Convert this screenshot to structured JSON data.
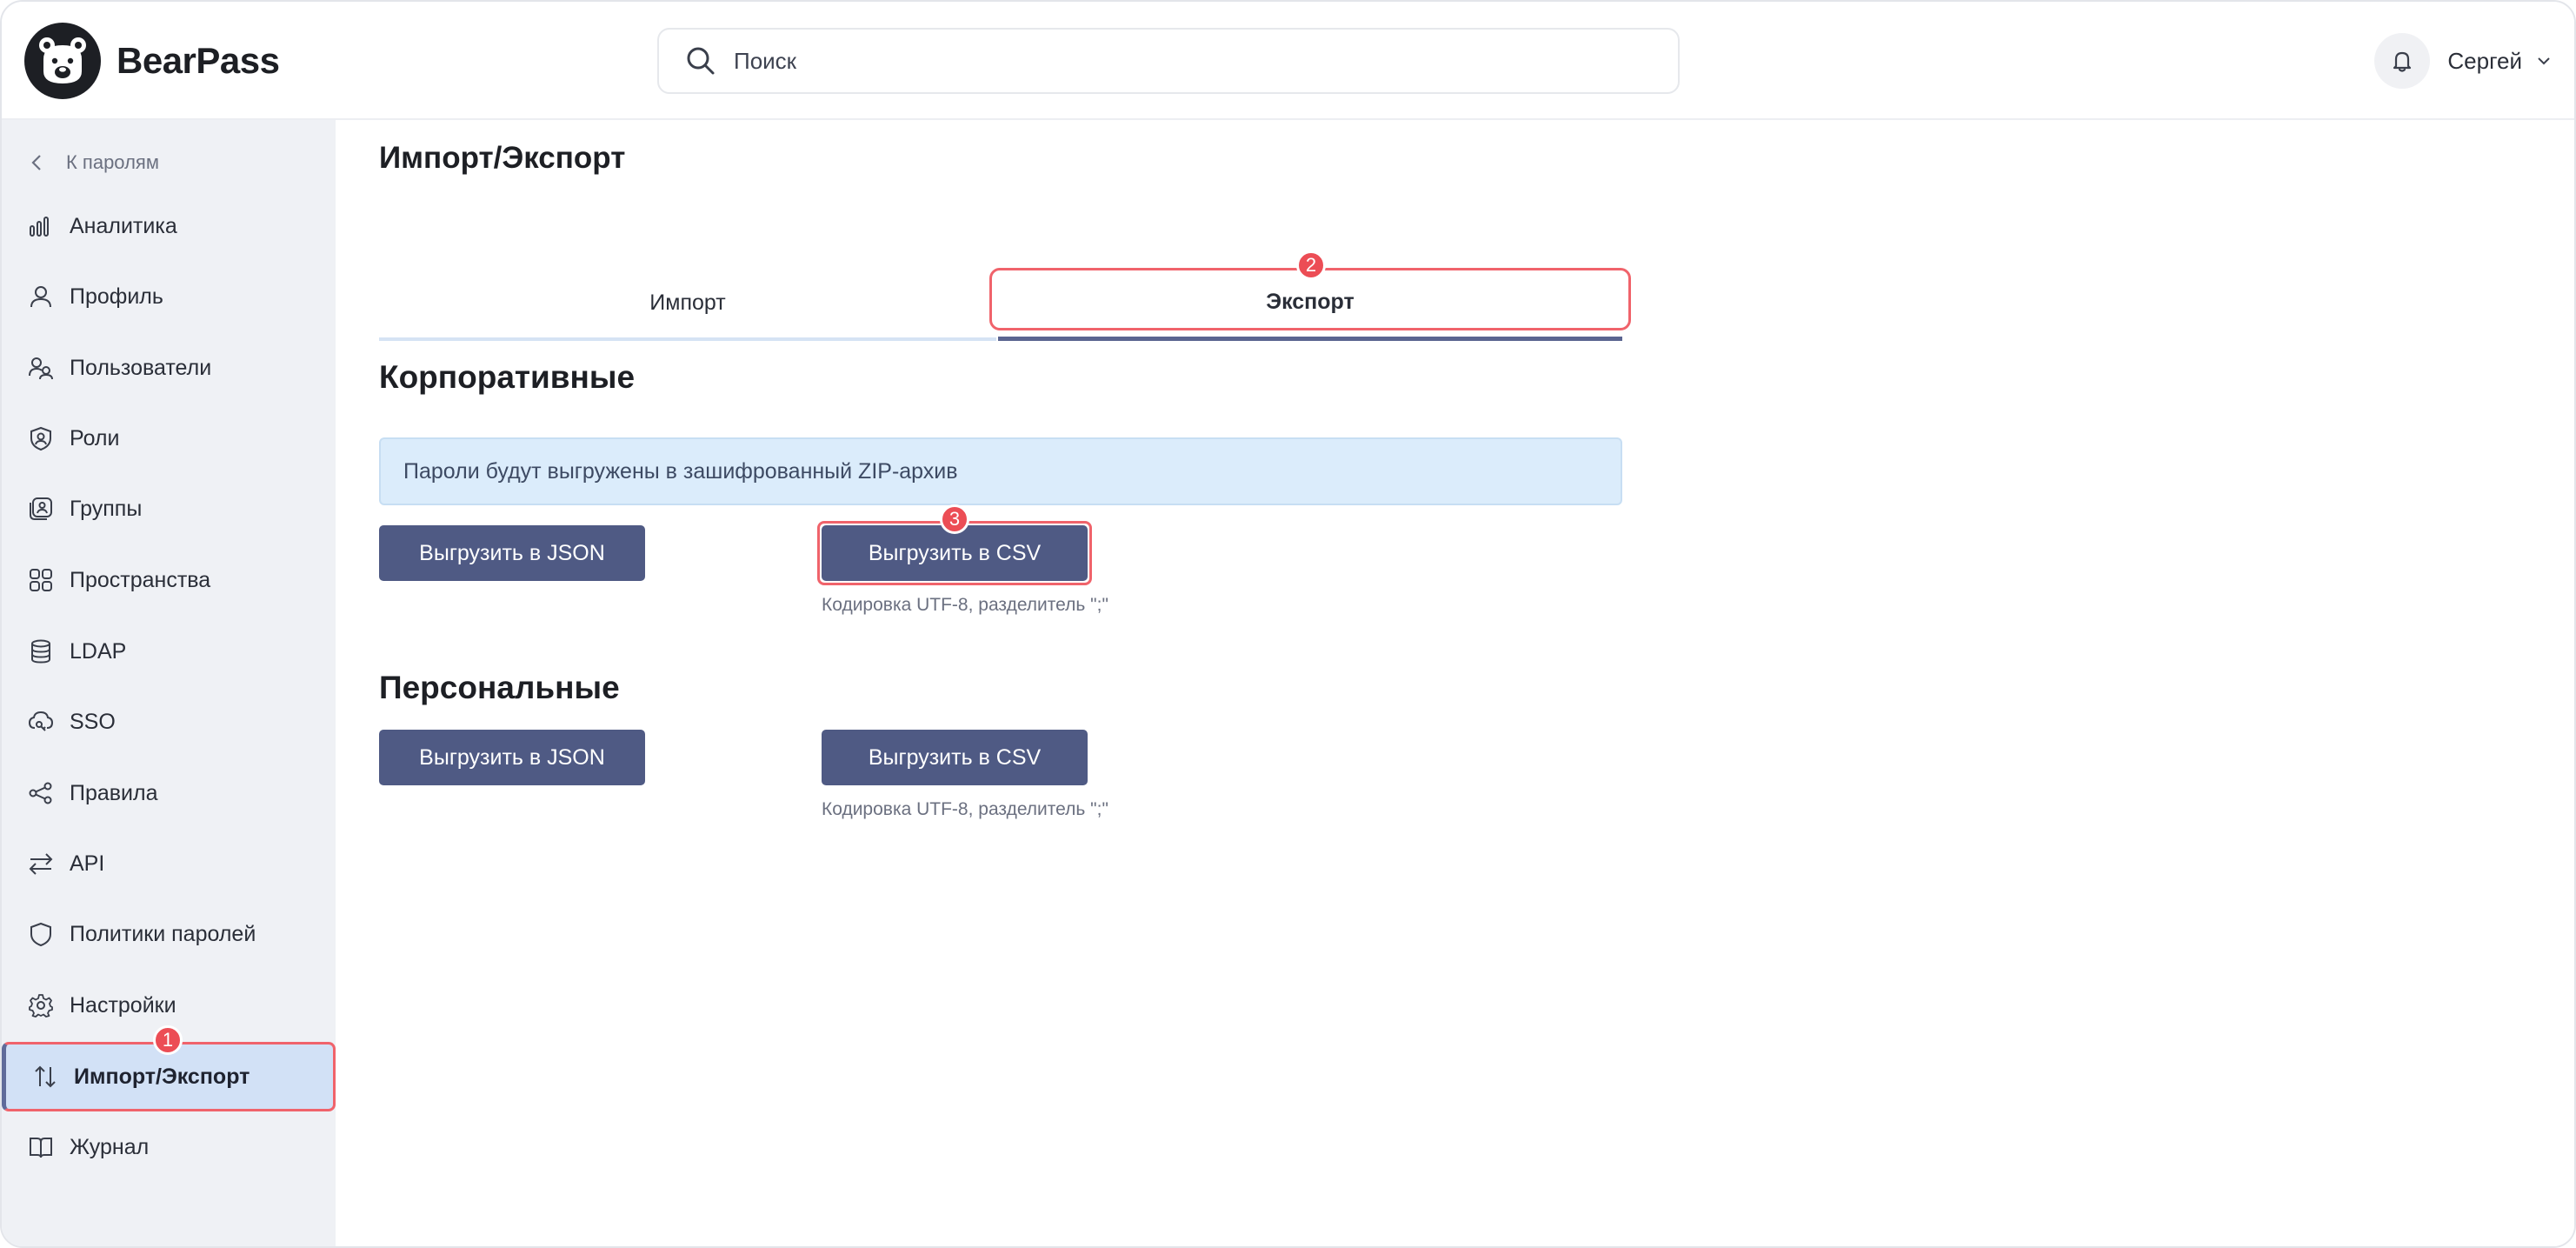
{
  "app": {
    "name": "BearPass"
  },
  "header": {
    "search_placeholder": "Поиск",
    "user_name": "Сергей"
  },
  "sidebar": {
    "back_label": "К паролям",
    "items": [
      {
        "label": "Аналитика",
        "icon": "bar-chart-icon"
      },
      {
        "label": "Профиль",
        "icon": "user-icon"
      },
      {
        "label": "Пользователи",
        "icon": "users-icon"
      },
      {
        "label": "Роли",
        "icon": "role-shield-icon"
      },
      {
        "label": "Группы",
        "icon": "group-icon"
      },
      {
        "label": "Пространства",
        "icon": "grid-icon"
      },
      {
        "label": "LDAP",
        "icon": "database-icon"
      },
      {
        "label": "SSO",
        "icon": "cloud-key-icon"
      },
      {
        "label": "Правила",
        "icon": "share-nodes-icon"
      },
      {
        "label": "API",
        "icon": "swap-arrows-icon"
      },
      {
        "label": "Политики паролей",
        "icon": "shield-icon"
      },
      {
        "label": "Настройки",
        "icon": "gear-icon"
      },
      {
        "label": "Импорт/Экспорт",
        "icon": "import-export-icon",
        "active": true
      },
      {
        "label": "Журнал",
        "icon": "book-icon"
      }
    ]
  },
  "main": {
    "title": "Импорт/Экспорт",
    "tabs": [
      {
        "label": "Импорт"
      },
      {
        "label": "Экспорт",
        "active": true
      }
    ],
    "corporate": {
      "title": "Корпоративные",
      "info": "Пароли будут выгружены в зашифрованный ZIP-архив",
      "json_button": "Выгрузить в JSON",
      "csv_button": "Выгрузить в CSV",
      "csv_hint": "Кодировка UTF-8, разделитель \";\""
    },
    "personal": {
      "title": "Персональные",
      "json_button": "Выгрузить в JSON",
      "csv_button": "Выгрузить в CSV",
      "csv_hint": "Кодировка UTF-8, разделитель \";\""
    }
  },
  "markers": {
    "m1": "1",
    "m2": "2",
    "m3": "3"
  },
  "colors": {
    "accent": "#4f5a84",
    "highlight": "#f0636b",
    "active_bg": "#d2e1f6",
    "sidebar_bg": "#eff1f5",
    "info_bg": "#dbecfb"
  }
}
